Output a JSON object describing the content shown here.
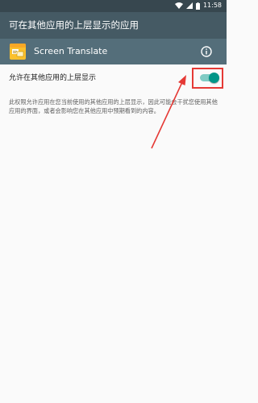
{
  "status_bar": {
    "time": "11:58"
  },
  "app_bar": {
    "title": "可在其他应用的上层显示的应用"
  },
  "app_header": {
    "name": "Screen Translate",
    "info_icon": "info-icon"
  },
  "setting": {
    "label": "允许在其他应用的上层显示",
    "enabled": true
  },
  "description": "此权限允许应用在您当前使用的其他应用的上层显示，因此可能会干扰您使用其他应用的界面，或者会影响您在其他应用中预期看到的内容。",
  "colors": {
    "status_bar": "#37474f",
    "app_bar": "#455a64",
    "app_header": "#546e7a",
    "toggle_on": "#009688",
    "annotation": "#e53935"
  }
}
